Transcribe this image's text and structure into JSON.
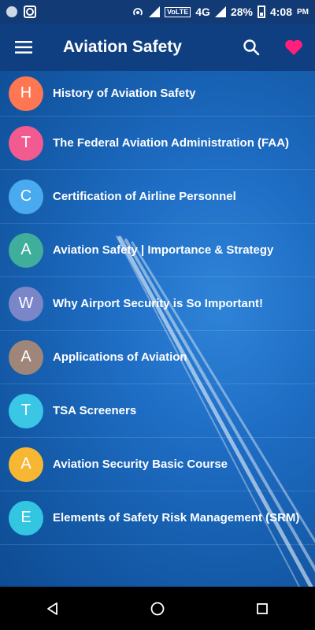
{
  "status_bar": {
    "network_label": "VoLTE",
    "signal_label": "4G",
    "battery_text": "28%",
    "time": "4:08",
    "ampm": "PM"
  },
  "app_bar": {
    "title": "Aviation Safety",
    "icons": [
      "menu-icon",
      "search-icon",
      "heart-icon"
    ],
    "accent_color": "#ff1f7a"
  },
  "topics": [
    {
      "letter": "H",
      "title": "History of Aviation Safety",
      "color": "#ff7652"
    },
    {
      "letter": "T",
      "title": "The Federal Aviation Administration (FAA)",
      "color": "#f25b8f"
    },
    {
      "letter": "C",
      "title": "Certification of Airline Personnel",
      "color": "#4aaaf0"
    },
    {
      "letter": "A",
      "title": "Aviation Safety | Importance & Strategy",
      "color": "#3fae9a"
    },
    {
      "letter": "W",
      "title": "Why Airport Security is So Important!",
      "color": "#7a86c8"
    },
    {
      "letter": "A",
      "title": "Applications of Aviation",
      "color": "#a0857a"
    },
    {
      "letter": "T",
      "title": "TSA Screeners",
      "color": "#3ac7e6"
    },
    {
      "letter": "A",
      "title": "Aviation Security Basic Course",
      "color": "#f7b733"
    },
    {
      "letter": "E",
      "title": "Elements of Safety Risk Management (SRM)",
      "color": "#32c6e0"
    }
  ],
  "nav_bar": {
    "buttons": [
      "back-icon",
      "home-icon",
      "recents-icon"
    ]
  }
}
